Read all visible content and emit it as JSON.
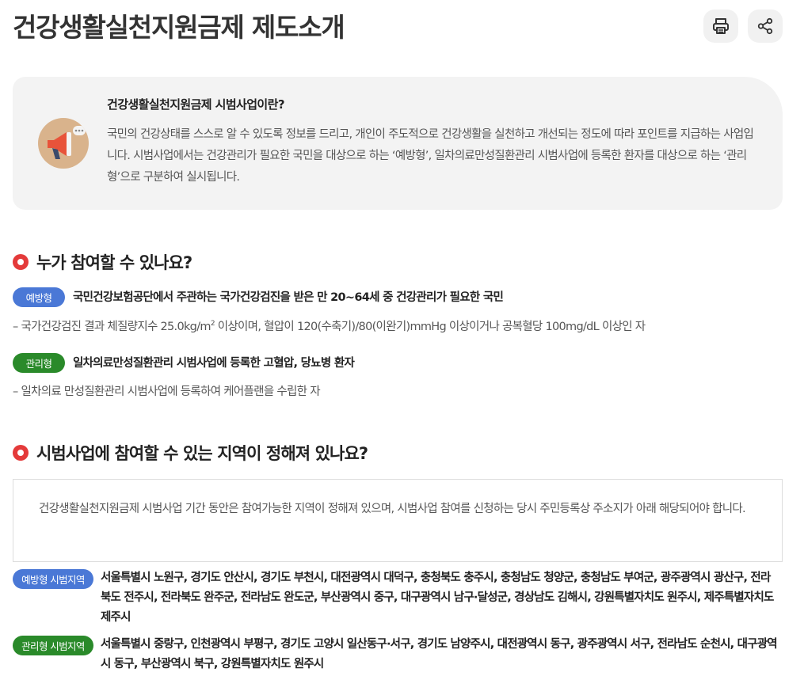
{
  "page": {
    "title": "건강생활실천지원금제 제도소개"
  },
  "toolbar": {
    "print_icon": "print-icon",
    "share_icon": "share-icon"
  },
  "intro": {
    "icon": "megaphone-icon",
    "title": "건강생활실천지원금제 시범사업이란?",
    "text": "국민의 건강상태를 스스로 알 수 있도록 정보를 드리고, 개인이 주도적으로 건강생활을 실천하고 개선되는 정도에 따라 포인트를 지급하는 사업입니다. 시범사업에서는 건강관리가 필요한 국민을 대상으로 하는 ‘예방형’, 일차의료만성질환관리 시범사업에 등록한 환자를 대상으로 하는 ‘관리형’으로 구분하여 실시됩니다."
  },
  "eligibility": {
    "heading": "누가 참여할 수 있나요?",
    "prevention": {
      "badge": "예방형",
      "title": "국민건강보험공단에서 주관하는 국가건강검진을 받은 만 20~64세 중 건강관리가 필요한 국민",
      "desc_before": "– 국가건강검진 결과 체질량지수 25.0kg/m",
      "desc_sup": "2",
      "desc_after": " 이상이며, 혈압이 120(수축기)/80(이완기)mmHg 이상이거나 공복혈당 100mg/dL 이상인 자"
    },
    "management": {
      "badge": "관리형",
      "title": "일차의료만성질환관리 시범사업에 등록한 고혈압, 당뇨병 환자",
      "desc": "– 일차의료 만성질환관리 시범사업에 등록하여 케어플랜을 수립한 자"
    }
  },
  "regions": {
    "heading": "시범사업에 참여할 수 있는 지역이 정해져 있나요?",
    "notice": "건강생활실천지원금제 시범사업 기간 동안은 참여가능한 지역이 정해져 있으며, 시범사업 참여를 신청하는 당시 주민등록상 주소지가 아래 해당되어야 합니다.",
    "prevention": {
      "badge": "예방형 시범지역",
      "areas": "서울특별시 노원구, 경기도 안산시, 경기도 부천시, 대전광역시 대덕구, 충청북도 충주시, 충청남도 청양군, 충청남도 부여군, 광주광역시 광산구, 전라북도 전주시, 전라북도 완주군, 전라남도 완도군, 부산광역시 중구, 대구광역시 남구·달성군, 경상남도 김해시, 강원특별자치도 원주시, 제주특별자치도 제주시"
    },
    "management": {
      "badge": "관리형 시범지역",
      "areas": "서울특별시 중랑구, 인천광역시 부평구, 경기도 고양시 일산동구·서구, 경기도 남양주시, 대전광역시 동구, 광주광역시 서구, 전라남도 순천시, 대구광역시 동구, 부산광역시 북구, 강원특별자치도 원주시"
    }
  },
  "colors": {
    "accent_blue": "#4a78d6",
    "accent_green": "#2a8a2a",
    "heading_dot": "#e43a3a"
  }
}
